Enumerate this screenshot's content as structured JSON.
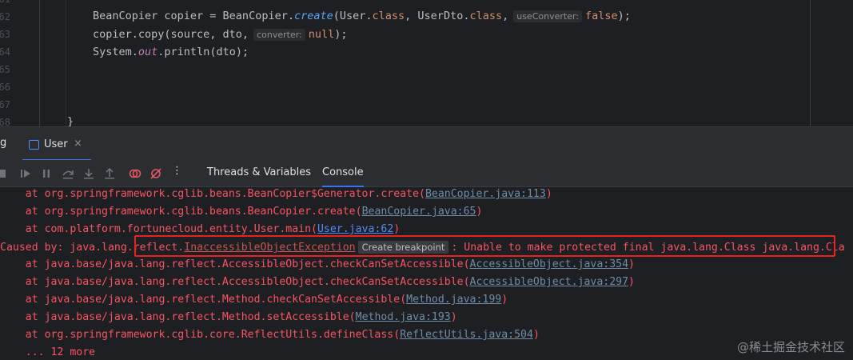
{
  "editor": {
    "line_numbers": [
      "61",
      "62",
      "63",
      "64",
      "65",
      "66",
      "67",
      "68"
    ],
    "line1": {
      "a": "BeanCopier copier = BeanCopier.",
      "method": "create",
      "b": "(User.",
      "kw1": "class",
      "c": ", UserDto.",
      "kw2": "class",
      "d": ",",
      "hint": "useConverter:",
      "val": "false",
      "e": ");"
    },
    "line2": {
      "a": "copier.copy(source, dto,",
      "hint": "converter:",
      "val": "null",
      "b": ");"
    },
    "line3": {
      "a": "System.",
      "field": "out",
      "b": ".println(dto);"
    },
    "closing_brace": "}"
  },
  "tool_window": {
    "fragment": "g",
    "tab_label": "User",
    "tab_close": "×"
  },
  "toolbar": {
    "tabs": [
      {
        "label": "Threads & Variables"
      },
      {
        "label": "Console"
      }
    ],
    "more_icon": "⋮"
  },
  "console": {
    "lines": [
      {
        "prefix": "    at org.springframework.cglib.beans.BeanCopier$Generator.create(",
        "link": "BeanCopier.java:113",
        "suffix": ")"
      },
      {
        "prefix": "    at org.springframework.cglib.beans.BeanCopier.create(",
        "link": "BeanCopier.java:65",
        "suffix": ")"
      },
      {
        "prefix": "    at com.platform.fortunecloud.entity.User.main(",
        "link": "User.java:62",
        "suffix": ")"
      },
      {
        "prefix": "    at java.base/java.lang.reflect.AccessibleObject.checkCanSetAccessible(",
        "link": "AccessibleObject.java:354",
        "suffix": ")"
      },
      {
        "prefix": "    at java.base/java.lang.reflect.AccessibleObject.checkCanSetAccessible(",
        "link": "AccessibleObject.java:297",
        "suffix": ")"
      },
      {
        "prefix": "    at java.base/java.lang.reflect.Method.checkCanSetAccessible(",
        "link": "Method.java:199",
        "suffix": ")"
      },
      {
        "prefix": "    at java.base/java.lang.reflect.Method.setAccessible(",
        "link": "Method.java:193",
        "suffix": ")"
      },
      {
        "prefix": "    at org.springframework.cglib.core.ReflectUtils.defineClass(",
        "link": "ReflectUtils.java:504",
        "suffix": ")"
      }
    ],
    "caused_by": {
      "prefix": "Caused by: java.lang.reflect.",
      "exception": "InaccessibleObjectException",
      "breakpoint_hint": "Create breakpoint",
      "message": ": Unable to make protected final java.lang.Class java.lang.Cla"
    },
    "more": "    ... 12 more"
  },
  "watermark": "@稀土掘金技术社区",
  "colors": {
    "error_text": "#f75464",
    "highlight_box": "#e8221f",
    "accent": "#3574f0"
  }
}
